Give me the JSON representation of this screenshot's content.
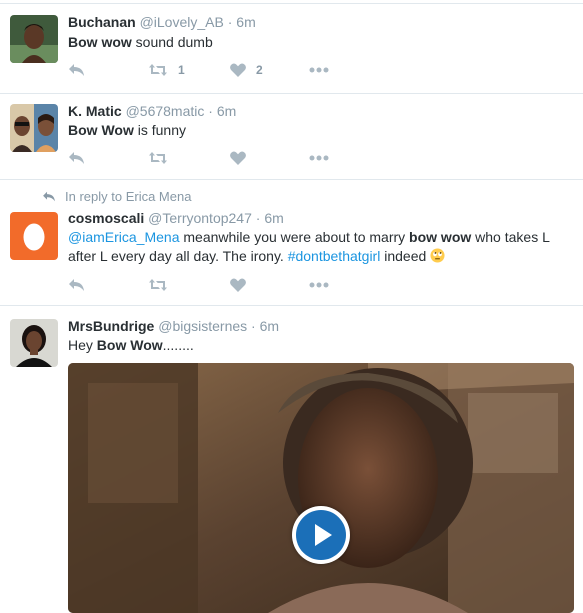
{
  "tweets": [
    {
      "name": "Buchanan",
      "handle": "@iLovely_AB",
      "separator": "·",
      "time": "6m",
      "text_bold": "Bow wow",
      "text_rest": " sound dumb",
      "retweets": "1",
      "likes": "2"
    },
    {
      "name": "K. Matic",
      "handle": "@5678matic",
      "separator": "·",
      "time": "6m",
      "text_bold": "Bow Wow",
      "text_rest": " is funny",
      "retweets": "",
      "likes": ""
    },
    {
      "reply_context": "In reply to Erica Mena",
      "name": "cosmoscali",
      "handle": "@Terryontop247",
      "separator": "·",
      "time": "6m",
      "mention": "@iamErica_Mena",
      "text_a": " meanwhile you were about to marry ",
      "text_bold": "bow wow",
      "text_b": " who takes L after L every day all day. The irony. ",
      "hashtag": "#dontbethatgirl",
      "text_c": " indeed ",
      "retweets": "",
      "likes": ""
    },
    {
      "name": "MrsBundrige",
      "handle": "@bigsisternes",
      "separator": "·",
      "time": "6m",
      "text_a": "Hey ",
      "text_bold": "Bow Wow",
      "text_b": "........"
    }
  ],
  "icons": {
    "reply": "reply-icon",
    "retweet": "retweet-icon",
    "like": "heart-icon",
    "more": "more-icon",
    "play": "play-icon",
    "emoji": "eye-roll-emoji-icon"
  },
  "colors": {
    "link": "#1b95e0",
    "meta": "#8899a6",
    "action": "#aab8c2",
    "play_button": "#1b6fb8"
  }
}
